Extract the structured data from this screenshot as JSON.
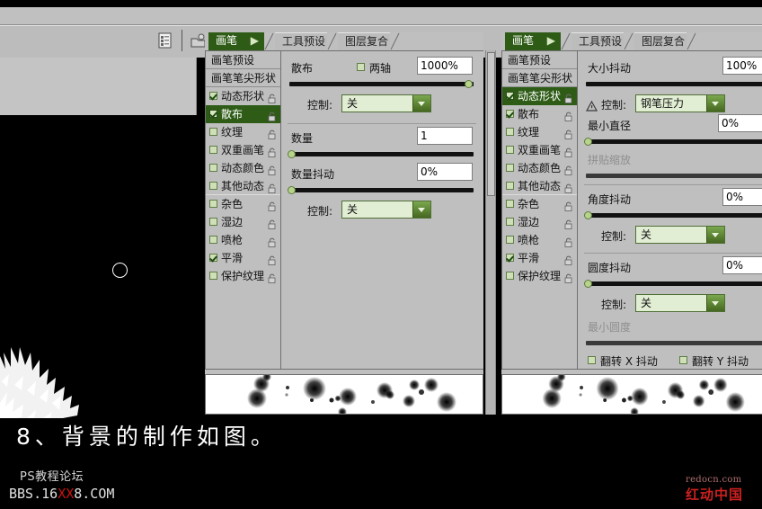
{
  "toolbar": {
    "doc_icon": "document-list-icon",
    "folder_icon": "open-folder-icon"
  },
  "canvas": {
    "brush_cursor": "circle-brush-cursor"
  },
  "caption": {
    "text": "8、背景的制作如图。",
    "watermark_line1": "PS教程论坛",
    "watermark_line2_pre": "BBS.16",
    "watermark_line2_red": "XX",
    "watermark_line2_post": "8.COM",
    "logo_line1": "redocn.com",
    "logo_line2": "红动中国"
  },
  "panel_left": {
    "tabs": [
      {
        "label": "画笔",
        "active": true
      },
      {
        "label": "工具预设",
        "active": false
      },
      {
        "label": "图层复合",
        "active": false
      }
    ],
    "list": [
      {
        "label": "画笔预设",
        "type": "header",
        "checked": false,
        "selected": false,
        "lock": false
      },
      {
        "label": "画笔笔尖形状",
        "type": "header",
        "checked": false,
        "selected": false,
        "lock": false
      },
      {
        "label": "动态形状",
        "type": "item",
        "checked": true,
        "selected": false,
        "lock": true
      },
      {
        "label": "散布",
        "type": "item",
        "checked": true,
        "selected": true,
        "lock": true
      },
      {
        "label": "纹理",
        "type": "item",
        "checked": false,
        "selected": false,
        "lock": true
      },
      {
        "label": "双重画笔",
        "type": "item",
        "checked": false,
        "selected": false,
        "lock": true
      },
      {
        "label": "动态颜色",
        "type": "item",
        "checked": false,
        "selected": false,
        "lock": true
      },
      {
        "label": "其他动态",
        "type": "item",
        "checked": false,
        "selected": false,
        "lock": true
      },
      {
        "label": "杂色",
        "type": "item",
        "checked": false,
        "selected": false,
        "lock": true
      },
      {
        "label": "湿边",
        "type": "item",
        "checked": false,
        "selected": false,
        "lock": true
      },
      {
        "label": "喷枪",
        "type": "item",
        "checked": false,
        "selected": false,
        "lock": true
      },
      {
        "label": "平滑",
        "type": "item",
        "checked": true,
        "selected": false,
        "lock": true
      },
      {
        "label": "保护纹理",
        "type": "item",
        "checked": false,
        "selected": false,
        "lock": true
      }
    ],
    "settings": {
      "scatter_label": "散布",
      "scatter_both_axes_label": "两轴",
      "scatter_both_axes_checked": false,
      "scatter_value": "1000%",
      "scatter_slider_pct": 100,
      "control1_label": "控制:",
      "control1_value": "关",
      "count_label": "数量",
      "count_value": "1",
      "count_slider_pct": 0,
      "count_jitter_label": "数量抖动",
      "count_jitter_value": "0%",
      "count_jitter_slider_pct": 0,
      "control2_label": "控制:",
      "control2_value": "关"
    }
  },
  "panel_right": {
    "tabs": [
      {
        "label": "画笔",
        "active": true
      },
      {
        "label": "工具预设",
        "active": false
      },
      {
        "label": "图层复合",
        "active": false
      }
    ],
    "list": [
      {
        "label": "画笔预设",
        "type": "header",
        "checked": false,
        "selected": false,
        "lock": false
      },
      {
        "label": "画笔笔尖形状",
        "type": "header",
        "checked": false,
        "selected": false,
        "lock": false
      },
      {
        "label": "动态形状",
        "type": "item",
        "checked": true,
        "selected": true,
        "lock": true
      },
      {
        "label": "散布",
        "type": "item",
        "checked": true,
        "selected": false,
        "lock": true
      },
      {
        "label": "纹理",
        "type": "item",
        "checked": false,
        "selected": false,
        "lock": true
      },
      {
        "label": "双重画笔",
        "type": "item",
        "checked": false,
        "selected": false,
        "lock": true
      },
      {
        "label": "动态颜色",
        "type": "item",
        "checked": false,
        "selected": false,
        "lock": true
      },
      {
        "label": "其他动态",
        "type": "item",
        "checked": false,
        "selected": false,
        "lock": true
      },
      {
        "label": "杂色",
        "type": "item",
        "checked": false,
        "selected": false,
        "lock": true
      },
      {
        "label": "湿边",
        "type": "item",
        "checked": false,
        "selected": false,
        "lock": true
      },
      {
        "label": "喷枪",
        "type": "item",
        "checked": false,
        "selected": false,
        "lock": true
      },
      {
        "label": "平滑",
        "type": "item",
        "checked": true,
        "selected": false,
        "lock": true
      },
      {
        "label": "保护纹理",
        "type": "item",
        "checked": false,
        "selected": false,
        "lock": true
      }
    ],
    "settings": {
      "size_jitter_label": "大小抖动",
      "size_jitter_value": "100%",
      "size_jitter_slider_pct": 100,
      "control1_label": "控制:",
      "control1_value": "钢笔压力",
      "control1_warning_icon": "warning-triangle-icon",
      "min_diameter_label": "最小直径",
      "min_diameter_value": "0%",
      "min_diameter_slider_pct": 0,
      "tilt_scale_label": "拼贴缩放",
      "angle_jitter_label": "角度抖动",
      "angle_jitter_value": "0%",
      "angle_jitter_slider_pct": 0,
      "control2_label": "控制:",
      "control2_value": "关",
      "roundness_jitter_label": "圆度抖动",
      "roundness_jitter_value": "0%",
      "roundness_jitter_slider_pct": 0,
      "control3_label": "控制:",
      "control3_value": "关",
      "min_roundness_label": "最小圆度",
      "flip_x_label": "翻转 X 抖动",
      "flip_x_checked": false,
      "flip_y_label": "翻转 Y 抖动",
      "flip_y_checked": false
    }
  },
  "colors": {
    "accent_green": "#2e5c16",
    "panel_bg": "#bfbfbf",
    "chrome_bg": "#c0c0c0",
    "combo_bg": "#e2eed4",
    "red": "#cc1010"
  }
}
